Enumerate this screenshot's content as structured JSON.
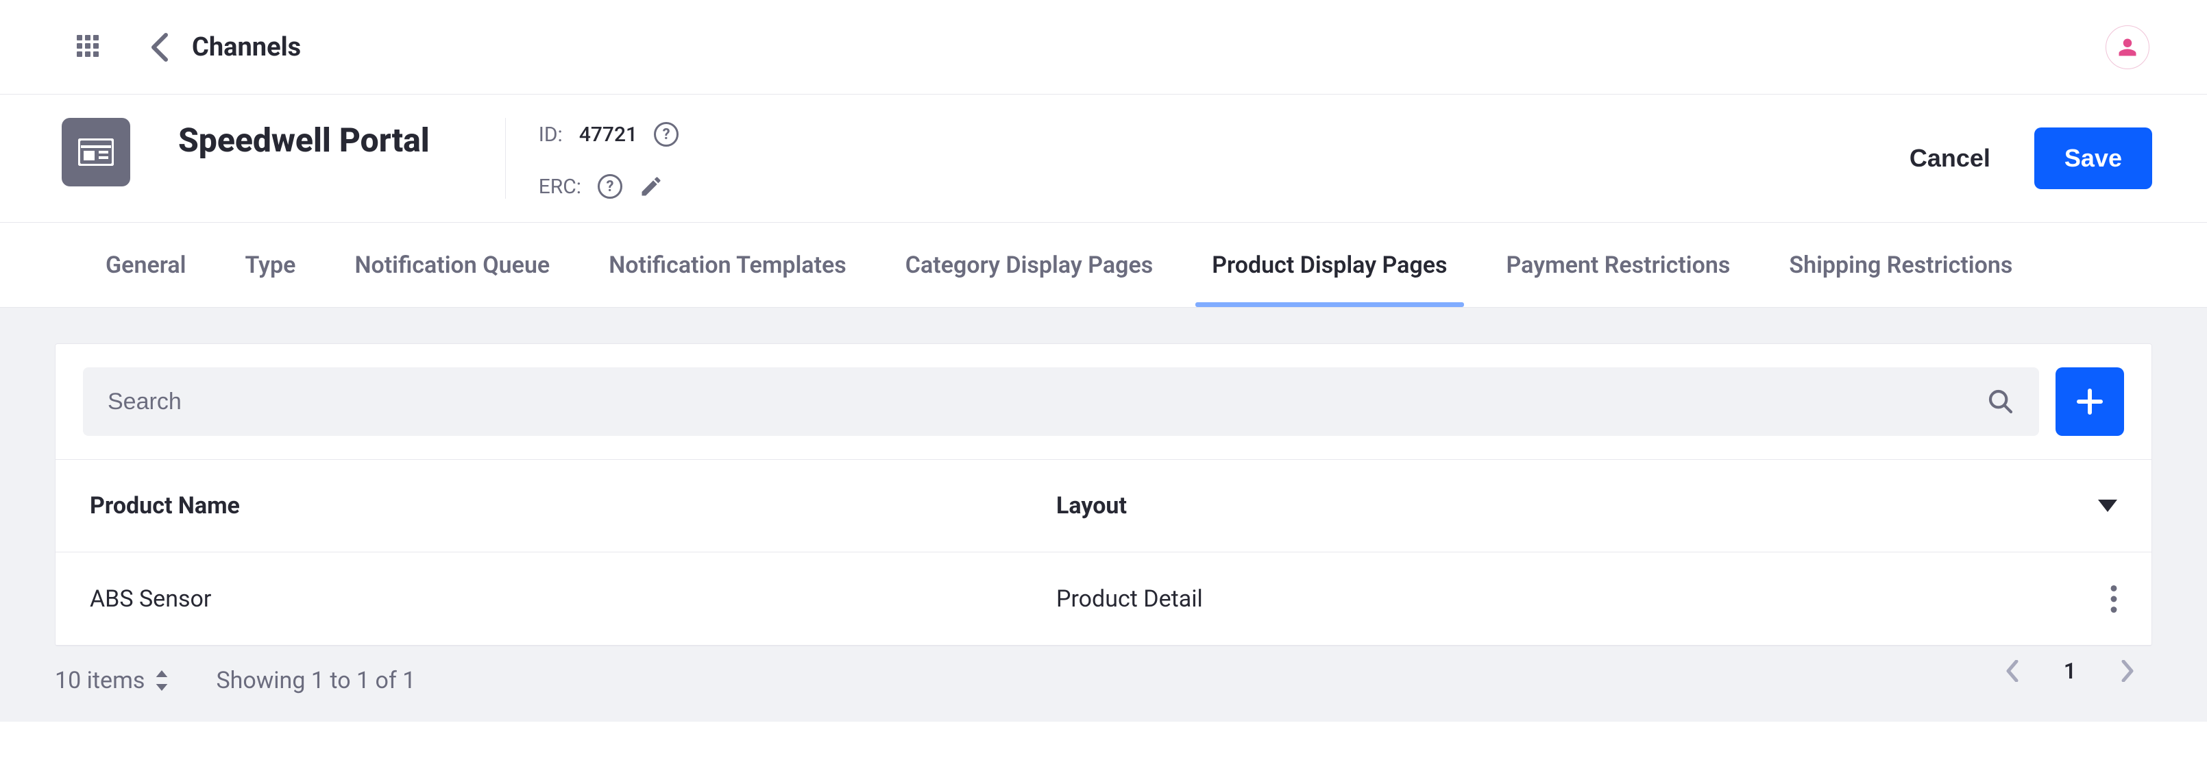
{
  "topbar": {
    "section_title": "Channels"
  },
  "channel": {
    "name": "Speedwell Portal",
    "id_label": "ID:",
    "id_value": "47721",
    "erc_label": "ERC:"
  },
  "actions": {
    "cancel": "Cancel",
    "save": "Save"
  },
  "tabs": [
    {
      "label": "General",
      "key": "general"
    },
    {
      "label": "Type",
      "key": "type"
    },
    {
      "label": "Notification Queue",
      "key": "notification-queue"
    },
    {
      "label": "Notification Templates",
      "key": "notification-templates"
    },
    {
      "label": "Category Display Pages",
      "key": "category-display-pages"
    },
    {
      "label": "Product Display Pages",
      "key": "product-display-pages"
    },
    {
      "label": "Payment Restrictions",
      "key": "payment-restrictions"
    },
    {
      "label": "Shipping Restrictions",
      "key": "shipping-restrictions"
    }
  ],
  "active_tab_key": "product-display-pages",
  "search": {
    "placeholder": "Search"
  },
  "table": {
    "columns": {
      "product_name": "Product Name",
      "layout": "Layout"
    },
    "rows": [
      {
        "product_name": "ABS Sensor",
        "layout": "Product Detail"
      }
    ]
  },
  "pagination": {
    "items_per_label": "10 items",
    "showing": "Showing 1 to 1 of 1",
    "current_page": "1"
  }
}
